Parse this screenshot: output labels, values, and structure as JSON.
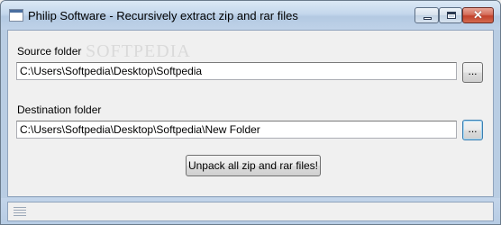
{
  "window": {
    "title": "Philip Software - Recursively extract zip and rar files",
    "controls": {
      "minimize_icon": "minimize-icon",
      "maximize_icon": "maximize-icon",
      "close_glyph": "✕"
    }
  },
  "watermark": "SOFTPEDIA",
  "source": {
    "label": "Source folder",
    "value": "C:\\Users\\Softpedia\\Desktop\\Softpedia",
    "browse_label": "..."
  },
  "destination": {
    "label": "Destination folder",
    "value": "C:\\Users\\Softpedia\\Desktop\\Softpedia\\New Folder",
    "browse_label": "..."
  },
  "action": {
    "label": "Unpack all zip and rar files!"
  }
}
